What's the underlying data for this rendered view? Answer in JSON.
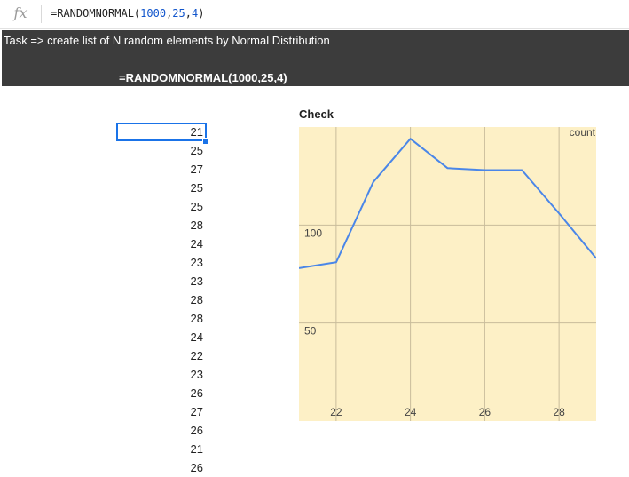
{
  "formula_bar": {
    "fx_label": "fx",
    "func": "=RANDOMNORMAL(",
    "a1": "1000",
    "a2": "25",
    "a3": "4",
    "close": ")"
  },
  "header": {
    "task": "Task => create list of N random elements by Normal Distribution",
    "formula": "=RANDOMNORMAL(1000,25,4)"
  },
  "cells": [
    "21",
    "25",
    "27",
    "25",
    "25",
    "28",
    "24",
    "23",
    "23",
    "28",
    "28",
    "24",
    "22",
    "23",
    "26",
    "27",
    "26",
    "21",
    "26"
  ],
  "chart": {
    "title": "Check",
    "colors": {
      "background": "#fdf0c6",
      "grid": "#c8bc9b",
      "line": "#4a86e8"
    }
  },
  "chart_data": {
    "type": "line",
    "title": "Check",
    "ylabel": "count",
    "xlim": [
      21,
      29
    ],
    "ylim": [
      0,
      150
    ],
    "x_ticks": [
      22,
      24,
      26,
      28
    ],
    "y_ticks": [
      50,
      100
    ],
    "grid": true,
    "series": [
      {
        "x": [
          21,
          22,
          23,
          24,
          25,
          26,
          27,
          28,
          29
        ],
        "values": [
          78,
          81,
          122,
          144,
          129,
          128,
          128,
          106,
          83
        ]
      }
    ]
  }
}
